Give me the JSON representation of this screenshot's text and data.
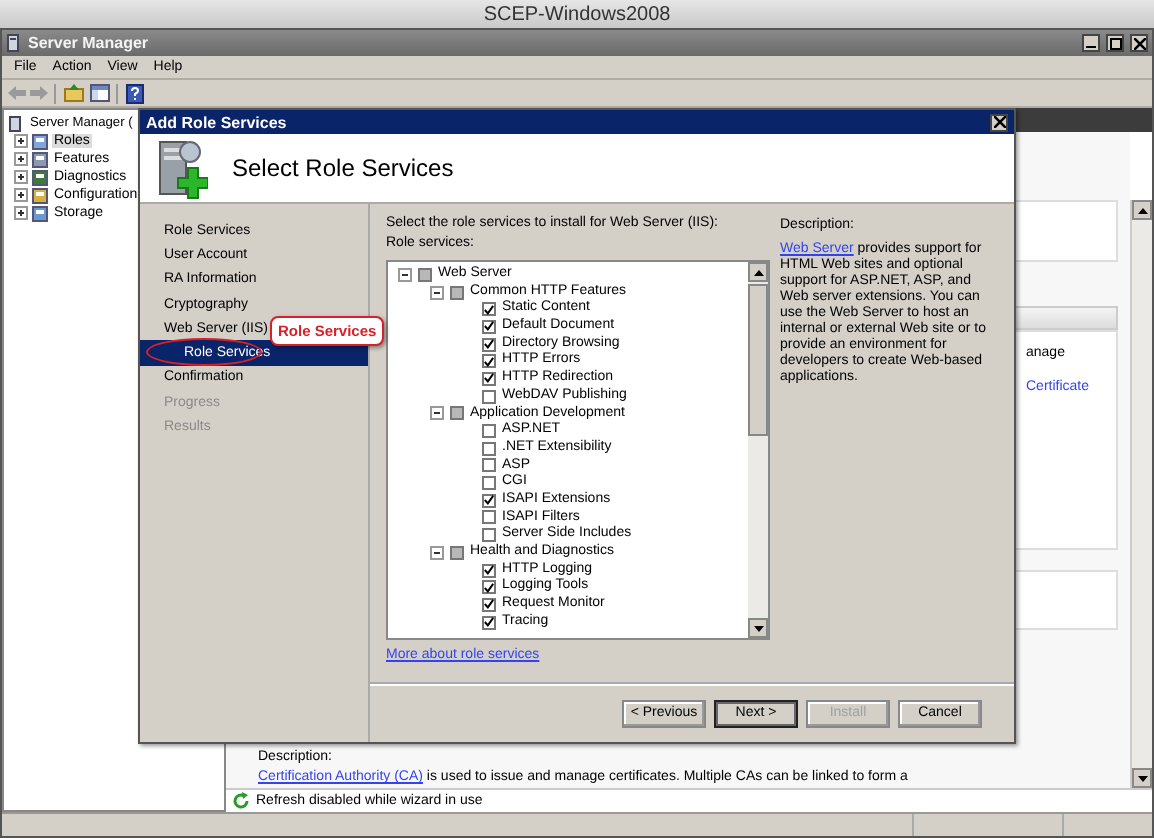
{
  "desktop": {
    "title": "SCEP-Windows2008"
  },
  "window": {
    "title": "Server Manager",
    "menu": [
      "File",
      "Action",
      "View",
      "Help"
    ]
  },
  "tree": {
    "root": "Server Manager (",
    "items": [
      {
        "label": "Roles",
        "selected": true,
        "expanded": false
      },
      {
        "label": "Features",
        "selected": false,
        "expanded": false
      },
      {
        "label": "Diagnostics",
        "selected": false,
        "expanded": false
      },
      {
        "label": "Configuration",
        "selected": false,
        "expanded": false
      },
      {
        "label": "Storage",
        "selected": false,
        "expanded": false
      }
    ]
  },
  "right_pane": {
    "text_fragment": "anage",
    "link_fragment": "Certificate",
    "description_label": "Description:",
    "description_link": "Certification Authority (CA)",
    "description_text": " is used to issue and manage certificates. Multiple CAs can be linked to form a",
    "refresh_notice": "Refresh disabled while wizard in use"
  },
  "dialog": {
    "title": "Add Role Services",
    "heading": "Select Role Services",
    "nav": [
      {
        "label": "Role Services",
        "selected": false,
        "disabled": false
      },
      {
        "label": "User Account",
        "selected": false,
        "disabled": false
      },
      {
        "label": "RA Information",
        "selected": false,
        "disabled": false
      },
      {
        "label": "Cryptography",
        "selected": false,
        "disabled": false
      },
      {
        "label": "Web Server (IIS)",
        "selected": false,
        "disabled": false,
        "children": [
          {
            "label": "Role Services",
            "selected": true,
            "disabled": false
          }
        ]
      },
      {
        "label": "Confirmation",
        "selected": false,
        "disabled": false
      },
      {
        "label": "Progress",
        "selected": false,
        "disabled": true
      },
      {
        "label": "Results",
        "selected": false,
        "disabled": true
      }
    ],
    "callout": "Role Services",
    "intro": "Select the role services to install for Web Server (IIS):",
    "list_label": "Role services:",
    "services": [
      {
        "kind": "group",
        "label": "Web Server",
        "expanded": true,
        "partial": true,
        "children": [
          {
            "kind": "group",
            "label": "Common HTTP Features",
            "expanded": true,
            "partial": true,
            "children": [
              {
                "kind": "item",
                "label": "Static Content",
                "checked": true
              },
              {
                "kind": "item",
                "label": "Default Document",
                "checked": true
              },
              {
                "kind": "item",
                "label": "Directory Browsing",
                "checked": true
              },
              {
                "kind": "item",
                "label": "HTTP Errors",
                "checked": true
              },
              {
                "kind": "item",
                "label": "HTTP Redirection",
                "checked": true
              },
              {
                "kind": "item",
                "label": "WebDAV Publishing",
                "checked": false
              }
            ]
          },
          {
            "kind": "group",
            "label": "Application Development",
            "expanded": true,
            "partial": true,
            "children": [
              {
                "kind": "item",
                "label": "ASP.NET",
                "checked": false
              },
              {
                "kind": "item",
                "label": ".NET Extensibility",
                "checked": false
              },
              {
                "kind": "item",
                "label": "ASP",
                "checked": false
              },
              {
                "kind": "item",
                "label": "CGI",
                "checked": false
              },
              {
                "kind": "item",
                "label": "ISAPI Extensions",
                "checked": true
              },
              {
                "kind": "item",
                "label": "ISAPI Filters",
                "checked": false
              },
              {
                "kind": "item",
                "label": "Server Side Includes",
                "checked": false
              }
            ]
          },
          {
            "kind": "group",
            "label": "Health and Diagnostics",
            "expanded": true,
            "partial": true,
            "children": [
              {
                "kind": "item",
                "label": "HTTP Logging",
                "checked": true
              },
              {
                "kind": "item",
                "label": "Logging Tools",
                "checked": true
              },
              {
                "kind": "item",
                "label": "Request Monitor",
                "checked": true
              },
              {
                "kind": "item",
                "label": "Tracing",
                "checked": true
              }
            ]
          }
        ]
      }
    ],
    "more_link": "More about role services",
    "description_label": "Description:",
    "description_link": "Web Server",
    "description_text": " provides support for HTML Web sites and optional support for ASP.NET, ASP, and Web server extensions. You can use the Web Server to host an internal or external Web site or to provide an environment for developers to create Web-based applications.",
    "buttons": [
      {
        "label": "< Previous",
        "disabled": false,
        "default": false
      },
      {
        "label": "Next >",
        "disabled": false,
        "default": true
      },
      {
        "label": "Install",
        "disabled": true,
        "default": false
      },
      {
        "label": "Cancel",
        "disabled": false,
        "default": false
      }
    ]
  }
}
